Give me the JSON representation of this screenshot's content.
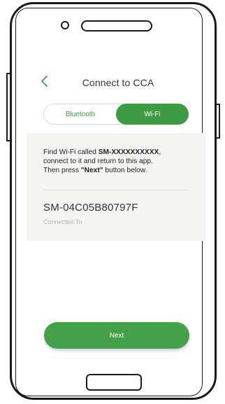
{
  "header": {
    "title": "Connect to CCA",
    "back_icon": "chevron-left-icon"
  },
  "tabs": {
    "bluetooth_label": "Bluetooth",
    "wifi_label": "Wi-Fi",
    "selected": "Wi-Fi"
  },
  "instructions": {
    "line_prefix": "Find Wi-Fi called ",
    "ssid_pattern": "SM-XXXXXXXXXX",
    "line_suffix": ",",
    "line2": "connect to it and return to this app.",
    "line3_prefix": "Then press ",
    "next_quoted": "\"Next\"",
    "line3_suffix": " button below."
  },
  "connection": {
    "device_name": "SM-04C05B80797F",
    "status_label": "Connected To"
  },
  "actions": {
    "next_label": "Next"
  },
  "colors": {
    "accent_green": "#3f9b43",
    "card_background": "#f3f5f1"
  }
}
